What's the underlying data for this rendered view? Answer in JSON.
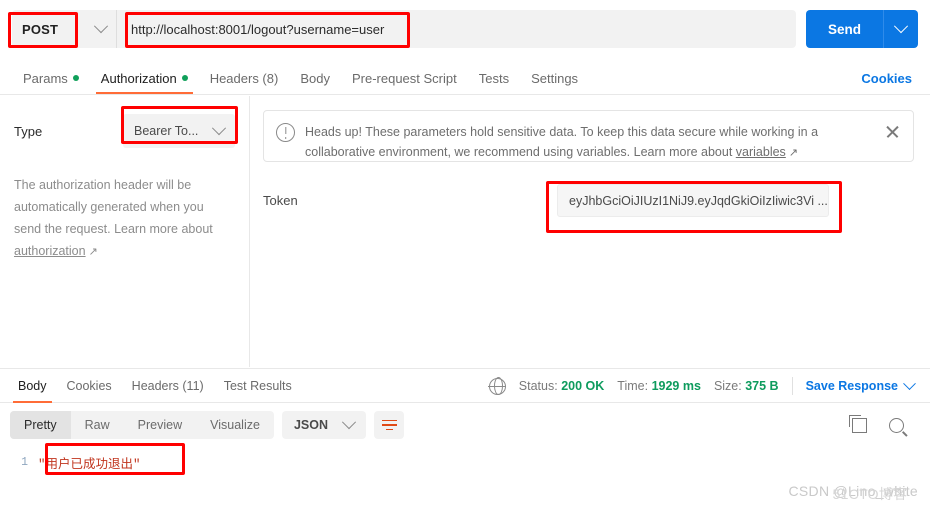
{
  "request": {
    "method": "POST",
    "url": "http://localhost:8001/logout?username=user",
    "send_label": "Send",
    "tabs": [
      {
        "label": "Params",
        "dot": true
      },
      {
        "label": "Authorization",
        "dot": true
      },
      {
        "label": "Headers (8)",
        "dot": false
      },
      {
        "label": "Body",
        "dot": false
      },
      {
        "label": "Pre-request Script",
        "dot": false
      },
      {
        "label": "Tests",
        "dot": false
      },
      {
        "label": "Settings",
        "dot": false
      }
    ],
    "active_tab": "Authorization",
    "cookies_label": "Cookies"
  },
  "auth": {
    "type_label": "Type",
    "type_value": "Bearer To...",
    "description": "The authorization header will be automatically generated when you send the request. Learn more about ",
    "description_link": "authorization",
    "notice": {
      "text": "Heads up! These parameters hold sensitive data. To keep this data secure while working in a collaborative environment, we recommend using variables. Learn more about ",
      "link": "variables"
    },
    "token_label": "Token",
    "token_value": "eyJhbGciOiJIUzI1NiJ9.eyJqdGkiOiIzIiwic3Vi ..."
  },
  "response": {
    "tabs": [
      "Body",
      "Cookies",
      "Headers (11)",
      "Test Results"
    ],
    "active_tab": "Body",
    "headers_count": "(11)",
    "status_label": "Status:",
    "status_value": "200 OK",
    "time_label": "Time:",
    "time_value": "1929 ms",
    "size_label": "Size:",
    "size_value": "375 B",
    "save_label": "Save Response",
    "format_tabs": [
      "Pretty",
      "Raw",
      "Preview",
      "Visualize"
    ],
    "active_format": "Pretty",
    "language": "JSON",
    "body_lines": [
      {
        "num": "1",
        "text": "\"用户已成功退出\""
      }
    ]
  },
  "watermark": {
    "primary": "CSDN @Lino_white",
    "secondary": "51CTO博客"
  },
  "colors": {
    "accent": "#ff6c37",
    "blue": "#0b77e3",
    "green": "#10a05a",
    "status_green": "#0d9b5d",
    "annotation_red": "#ff0000"
  }
}
